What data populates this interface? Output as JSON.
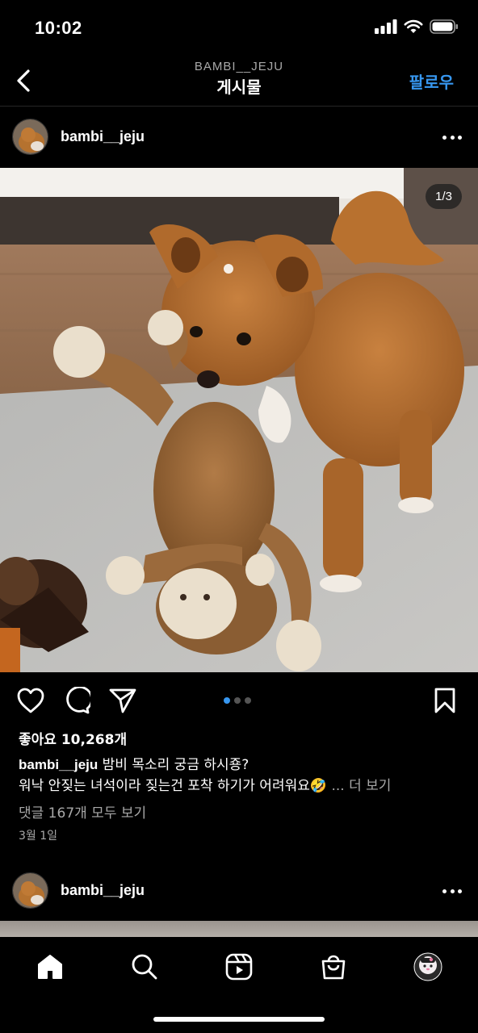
{
  "status_bar": {
    "time": "10:02"
  },
  "header": {
    "subtitle": "BAMBI__JEJU",
    "title": "게시물",
    "follow_label": "팔로우"
  },
  "post": {
    "username": "bambi__jeju",
    "image_counter": "1/3",
    "carousel": {
      "total": 3,
      "current": 1
    },
    "likes": "좋아요 10,268개",
    "caption_user": "bambi__jeju",
    "caption_line1": "밤비 목소리 궁금 하시죵?",
    "caption_line2": "워낙 안짖는 녀석이라 짖는건 포착 하기가 어려워요",
    "caption_emoji": "🤣",
    "more_label": "... 더 보기",
    "comments": "댓글 167개 모두 보기",
    "date": "3월 1일"
  },
  "next_post": {
    "username": "bambi__jeju"
  },
  "colors": {
    "accent": "#3797f0",
    "background": "#000000",
    "muted": "#a8a8a8"
  },
  "icons": {
    "back": "chevron-left-icon",
    "more": "more-horizontal-icon",
    "like": "heart-icon",
    "comment": "comment-icon",
    "share": "send-icon",
    "save": "bookmark-icon",
    "tabs": [
      "home-icon",
      "search-icon",
      "reels-icon",
      "shop-icon",
      "profile-avatar"
    ]
  }
}
